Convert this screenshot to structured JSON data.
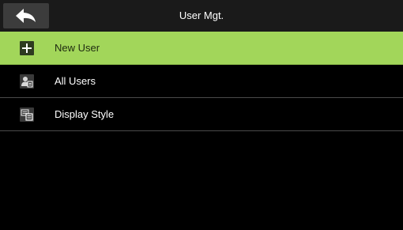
{
  "header": {
    "title": "User Mgt.",
    "back_icon": "back-arrow-icon"
  },
  "menu": {
    "items": [
      {
        "label": "New User",
        "icon": "plus-icon",
        "selected": true
      },
      {
        "label": "All Users",
        "icon": "user-list-icon",
        "selected": false
      },
      {
        "label": "Display Style",
        "icon": "display-style-icon",
        "selected": false
      }
    ]
  },
  "colors": {
    "background": "#000000",
    "titlebar": "#1a1a1a",
    "selected_row": "#a2d65a",
    "divider": "#4a4a4a",
    "back_button": "#3c3c3c"
  }
}
